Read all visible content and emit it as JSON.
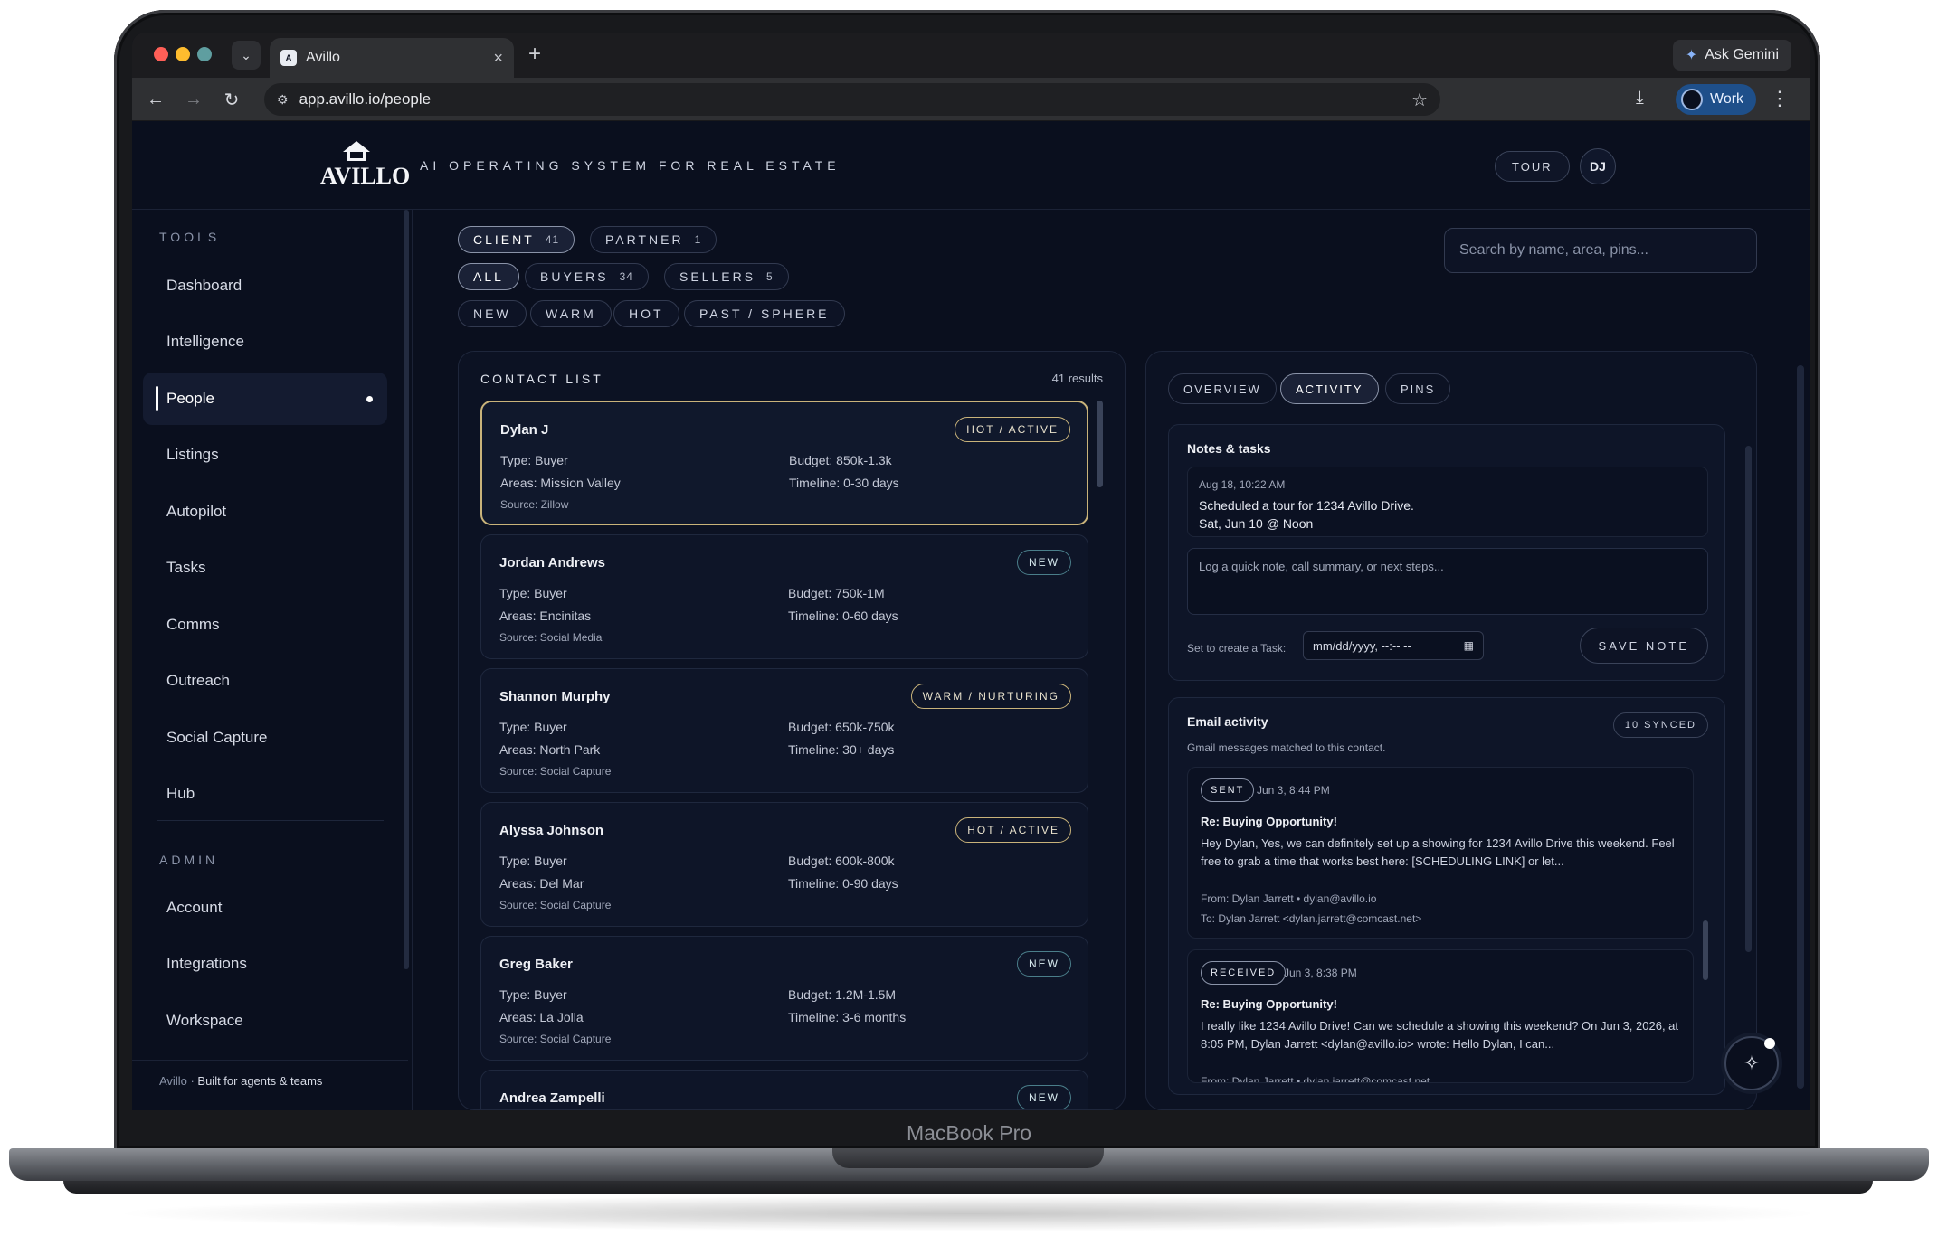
{
  "device": {
    "label": "MacBook Pro"
  },
  "browser": {
    "tab_title": "Avillo",
    "favicon_text": "A",
    "url": "app.avillo.io/people",
    "ask_gemini": "Ask Gemini",
    "profile": "Work"
  },
  "header": {
    "logo_text": "AVILLO",
    "tagline": "AI OPERATING SYSTEM FOR REAL ESTATE",
    "tour": "TOUR",
    "user_initials": "DJ"
  },
  "sidebar": {
    "tools_label": "TOOLS",
    "tools": [
      {
        "label": "Dashboard"
      },
      {
        "label": "Intelligence"
      },
      {
        "label": "People",
        "active": true
      },
      {
        "label": "Listings"
      },
      {
        "label": "Autopilot"
      },
      {
        "label": "Tasks"
      },
      {
        "label": "Comms"
      },
      {
        "label": "Outreach"
      },
      {
        "label": "Social Capture"
      },
      {
        "label": "Hub"
      }
    ],
    "admin_label": "ADMIN",
    "admin": [
      {
        "label": "Account"
      },
      {
        "label": "Integrations"
      },
      {
        "label": "Workspace"
      }
    ],
    "footer_brand": "Avillo",
    "footer_text": "Built for agents & teams"
  },
  "filters": {
    "row1": [
      {
        "label": "CLIENT",
        "count": "41",
        "selected": true
      },
      {
        "label": "PARTNER",
        "count": "1"
      }
    ],
    "row2": [
      {
        "label": "ALL",
        "selected": true
      },
      {
        "label": "BUYERS",
        "count": "34"
      },
      {
        "label": "SELLERS",
        "count": "5"
      }
    ],
    "row3": [
      {
        "label": "NEW"
      },
      {
        "label": "WARM"
      },
      {
        "label": "HOT"
      },
      {
        "label": "PAST / SPHERE"
      }
    ],
    "search_placeholder": "Search by name, area, pins..."
  },
  "contacts": {
    "title": "CONTACT LIST",
    "results": "41 results",
    "items": [
      {
        "name": "Dylan J",
        "badge": "HOT / ACTIVE",
        "type": "Type: Buyer",
        "areas": "Areas: Mission Valley",
        "source": "Source: Zillow",
        "budget": "Budget: 850k-1.3k",
        "timeline": "Timeline: 0-30 days"
      },
      {
        "name": "Jordan Andrews",
        "badge": "NEW",
        "type": "Type: Buyer",
        "areas": "Areas: Encinitas",
        "source": "Source: Social Media",
        "budget": "Budget: 750k-1M",
        "timeline": "Timeline: 0-60 days"
      },
      {
        "name": "Shannon Murphy",
        "badge": "WARM / NURTURING",
        "type": "Type: Buyer",
        "areas": "Areas: North Park",
        "source": "Source: Social Capture",
        "budget": "Budget: 650k-750k",
        "timeline": "Timeline: 30+ days"
      },
      {
        "name": "Alyssa Johnson",
        "badge": "HOT / ACTIVE",
        "type": "Type: Buyer",
        "areas": "Areas: Del Mar",
        "source": "Source: Social Capture",
        "budget": "Budget: 600k-800k",
        "timeline": "Timeline: 0-90 days"
      },
      {
        "name": "Greg Baker",
        "badge": "NEW",
        "type": "Type: Buyer",
        "areas": "Areas: La Jolla",
        "source": "Source: Social Capture",
        "budget": "Budget: 1.2M-1.5M",
        "timeline": "Timeline: 3-6 months"
      },
      {
        "name": "Andrea Zampelli",
        "badge": "NEW"
      }
    ]
  },
  "detail": {
    "tabs": [
      {
        "label": "OVERVIEW"
      },
      {
        "label": "ACTIVITY",
        "selected": true
      },
      {
        "label": "PINS"
      }
    ],
    "notes": {
      "title": "Notes & tasks",
      "entry_date": "Aug 18, 10:22 AM",
      "entry_line1": "Scheduled a tour for 1234 Avillo Drive.",
      "entry_line2": "Sat, Jun 10 @ Noon",
      "placeholder": "Log a quick note, call summary, or next steps...",
      "task_label": "Set to create a Task:",
      "date_placeholder": "mm/dd/yyyy, --:-- --",
      "save": "SAVE NOTE"
    },
    "email": {
      "title": "Email activity",
      "subtitle": "Gmail messages matched to this contact.",
      "synced": "10 SYNCED",
      "messages": [
        {
          "direction": "SENT",
          "time": "Jun 3, 8:44 PM",
          "subject": "Re: Buying Opportunity!",
          "body": "Hey Dylan, Yes, we can definitely set up a showing for 1234 Avillo Drive this weekend. Feel free to grab a time that works best here: [SCHEDULING LINK] or let...",
          "from": "From: Dylan Jarrett • dylan@avillo.io",
          "to": "To: Dylan Jarrett <dylan.jarrett@comcast.net>"
        },
        {
          "direction": "RECEIVED",
          "time": "Jun 3, 8:38 PM",
          "subject": "Re: Buying Opportunity!",
          "body": "I really like 1234 Avillo Drive! Can we schedule a showing this weekend? On Jun 3, 2026, at 8:05 PM, Dylan Jarrett <dylan@avillo.io> wrote: Hello Dylan, I can...",
          "from": "From: Dylan Jarrett • dylan.jarrett@comcast.net"
        }
      ]
    }
  },
  "icons": {
    "back": "←",
    "forward": "→",
    "reload": "↻",
    "site_info": "⚙",
    "star": "☆",
    "download": "⤓",
    "menu": "⋮",
    "close": "×",
    "plus": "+",
    "chevron": "⌄",
    "gemini": "✦",
    "calendar": "▦",
    "sparkle": "✧"
  },
  "colors": {
    "background": "#0a0f1e",
    "accent_gold": "#c9b37a",
    "accent_teal": "#4a7e8a"
  }
}
